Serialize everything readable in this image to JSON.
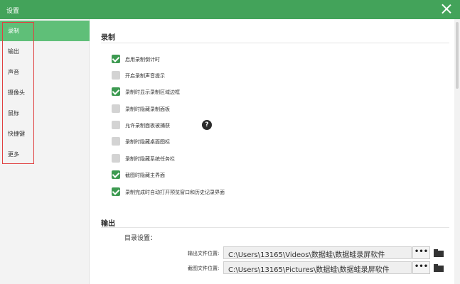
{
  "window": {
    "title": "设置"
  },
  "sidebar": {
    "items": [
      {
        "label": "录制",
        "active": true
      },
      {
        "label": "输出",
        "active": false
      },
      {
        "label": "声音",
        "active": false
      },
      {
        "label": "摄像头",
        "active": false
      },
      {
        "label": "鼠标",
        "active": false
      },
      {
        "label": "快捷键",
        "active": false
      },
      {
        "label": "更多",
        "active": false
      }
    ]
  },
  "record": {
    "title": "录制",
    "options": [
      {
        "label": "启用录制倒计时",
        "checked": true
      },
      {
        "label": "开启录制声音提示",
        "checked": false
      },
      {
        "label": "录制时显示录制区域边框",
        "checked": true
      },
      {
        "label": "录制时隐藏录制面板",
        "checked": false
      },
      {
        "label": "允许录制面板被捕获",
        "checked": false
      },
      {
        "label": "录制时隐藏桌面图标",
        "checked": false
      },
      {
        "label": "录制时隐藏系统任务栏",
        "checked": false
      },
      {
        "label": "截图时隐藏主界面",
        "checked": true
      },
      {
        "label": "录制完成时自动打开预览窗口和历史记录界面",
        "checked": true
      }
    ],
    "help_symbol": "?"
  },
  "output": {
    "title": "输出",
    "dir_label": "目录设置：",
    "paths": [
      {
        "label": "输出文件位置:",
        "value": "C:\\Users\\13165\\Videos\\数据蛙\\数据蛙录屏软件",
        "browse": "•••"
      },
      {
        "label": "截图文件位置:",
        "value": "C:\\Users\\13165\\Pictures\\数据蛙\\数据蛙录屏软件",
        "browse": "•••"
      }
    ]
  },
  "colors": {
    "accent": "#43a35a",
    "sidebar_active": "#5fbf78",
    "highlight_box": "#e04040"
  }
}
